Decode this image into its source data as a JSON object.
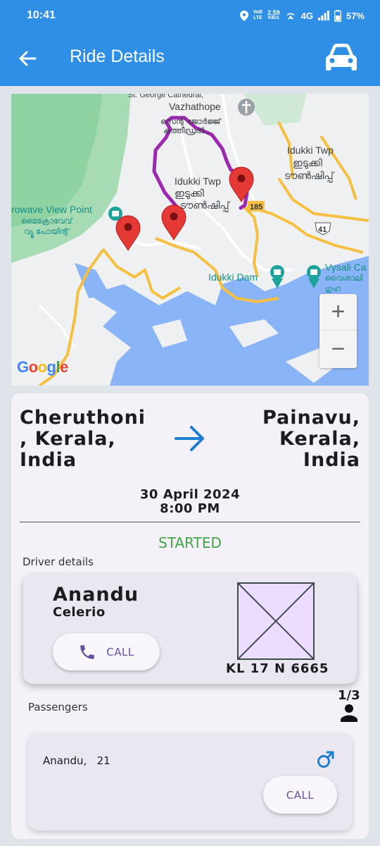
{
  "status_bar": {
    "time": "10:41",
    "volte_top": "VoB",
    "volte_bottom": "LTE",
    "speed_top": "2.59",
    "speed_bottom": "KB/s",
    "network": "4G",
    "battery": "57%"
  },
  "app_bar": {
    "title": "Ride Details",
    "back_icon": "arrow-left-icon",
    "action_icon": "car-icon"
  },
  "map": {
    "labels": {
      "cathedral_en_1": "St. George Cathedral,",
      "cathedral_en_2": "Vazhathope",
      "cathedral_ml_1": "സെന്റ് ജോർജ്ജ്",
      "cathedral_ml_2": "കത്തീഡ്രൽ...",
      "idukki_twp_right_en": "Idukki Twp",
      "idukki_twp_right_ml_1": "ഇടുക്കി",
      "idukki_twp_right_ml_2": "ടൗൺഷിപ്പ്",
      "idukki_twp_center_en": "Idukki Twp",
      "idukki_twp_center_ml_1": "ഇടുക്കി",
      "idukki_twp_center_ml_2": "ടൗൺഷിപ്പ്",
      "viewpoint_en": "rowave View Point",
      "viewpoint_ml_1": "മൈക്രോവേവ്",
      "viewpoint_ml_2": "വ്യൂ പോയിന്റ്",
      "dam": "Idukki Dam",
      "vysali_en": "Vysali Ca",
      "vysali_ml_1": "വൈശാലി",
      "vysali_ml_2": "ഗുഹ",
      "road_185": "185",
      "road_41": "41"
    },
    "zoom_in": "+",
    "zoom_out": "−",
    "attribution": "Google",
    "colors": {
      "route": "#9c27b0",
      "marker": "#e53935",
      "water": "#8ab4f8",
      "forest": "#9bd6a9"
    }
  },
  "ride": {
    "from": "Cheruthoni , Kerala, India",
    "to": "Painavu, Kerala, India",
    "date": "30 April 2024",
    "time": "8:00 PM",
    "status": "STARTED",
    "status_color": "#41a444"
  },
  "driver": {
    "section_label": "Driver details",
    "name": "Anandu",
    "car": "Celerio",
    "call_label": "CALL",
    "plate": "KL 17 N 6665"
  },
  "passengers": {
    "section_label": "Passengers",
    "count": "1/3",
    "items": [
      {
        "name_age": "Anandu,   21",
        "gender_icon": "male-icon",
        "call_label": "CALL"
      }
    ]
  }
}
